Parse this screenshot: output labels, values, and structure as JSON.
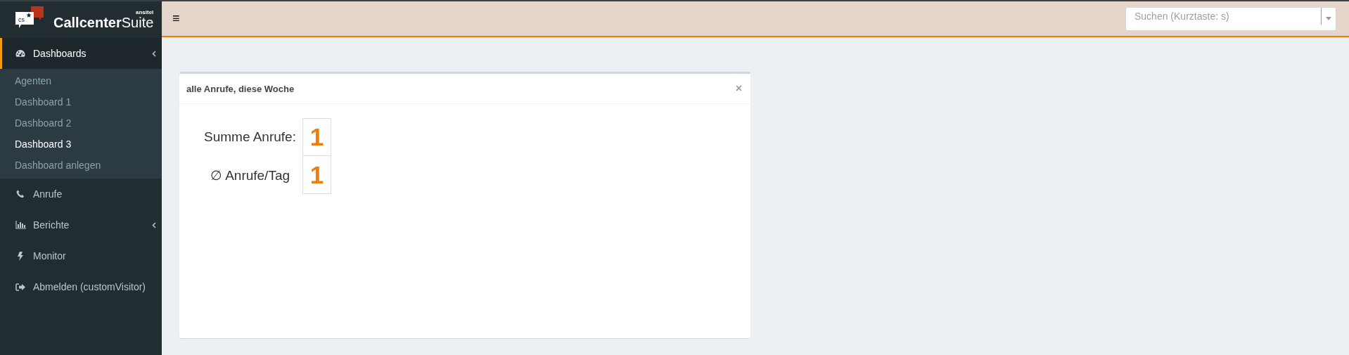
{
  "logo": {
    "badge": "cs",
    "brand": "**Callcenter**Suite",
    "maker": "ansitel"
  },
  "sidebar": {
    "items": [
      {
        "label": "Dashboards",
        "selected": true,
        "expandable": true,
        "children": [
          {
            "label": "Agenten",
            "selected": false
          },
          {
            "label": "Dashboard 1",
            "selected": false
          },
          {
            "label": "Dashboard 2",
            "selected": false
          },
          {
            "label": "Dashboard 3",
            "selected": true
          },
          {
            "label": "Dashboard anlegen",
            "selected": false
          }
        ]
      },
      {
        "label": "Anrufe",
        "selected": false,
        "expandable": false
      },
      {
        "label": "Berichte",
        "selected": false,
        "expandable": true
      },
      {
        "label": "Monitor",
        "selected": false,
        "expandable": false
      },
      {
        "label": "Abmelden (customVisitor)",
        "selected": false,
        "expandable": false
      }
    ]
  },
  "topbar": {
    "menu_toggle": "≡",
    "search": {
      "placeholder": "Suchen (Kurztaste: s)"
    }
  },
  "widget": {
    "title": "alle Anrufe, diese Woche",
    "close": "×",
    "rows": [
      {
        "label": "Summe Anrufe:",
        "value": "1"
      },
      {
        "label": "∅ Anrufe/Tag",
        "value": "1"
      }
    ]
  }
}
